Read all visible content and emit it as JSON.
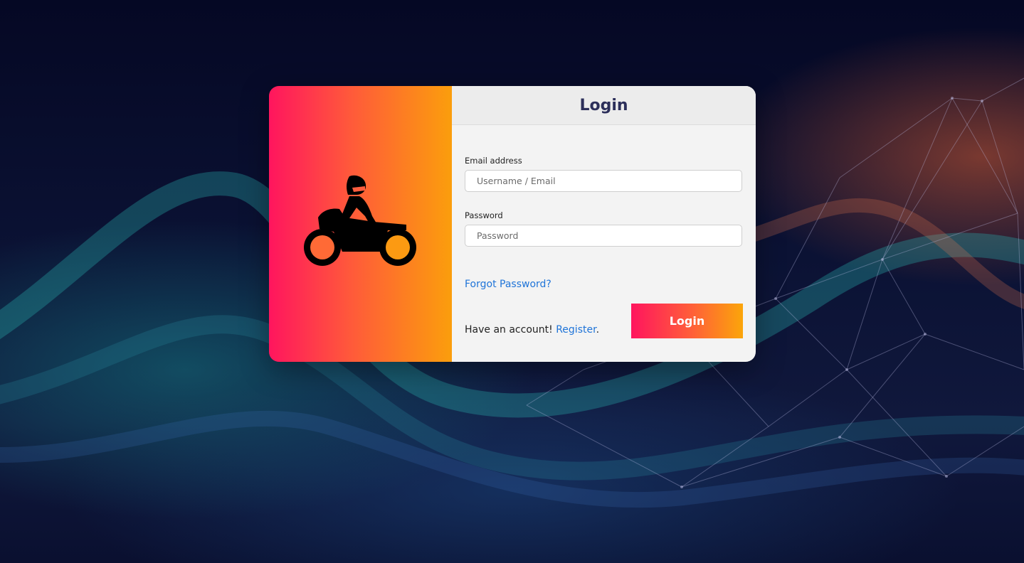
{
  "login_card": {
    "title": "Login",
    "email_label": "Email address",
    "email_placeholder": "Username / Email",
    "email_value": "",
    "password_label": "Password",
    "password_placeholder": "Password",
    "password_value": "",
    "forgot_password": "Forgot Password?",
    "register_prefix": "Have an account!",
    "register_link": "Register",
    "register_suffix": ".",
    "login_button": "Login"
  },
  "brand": {
    "icon": "motorcycle-rider-icon"
  },
  "colors": {
    "gradient_start": "#ff155e",
    "gradient_end": "#fba50a",
    "link": "#1f74d8",
    "title": "#2c2f5a"
  }
}
